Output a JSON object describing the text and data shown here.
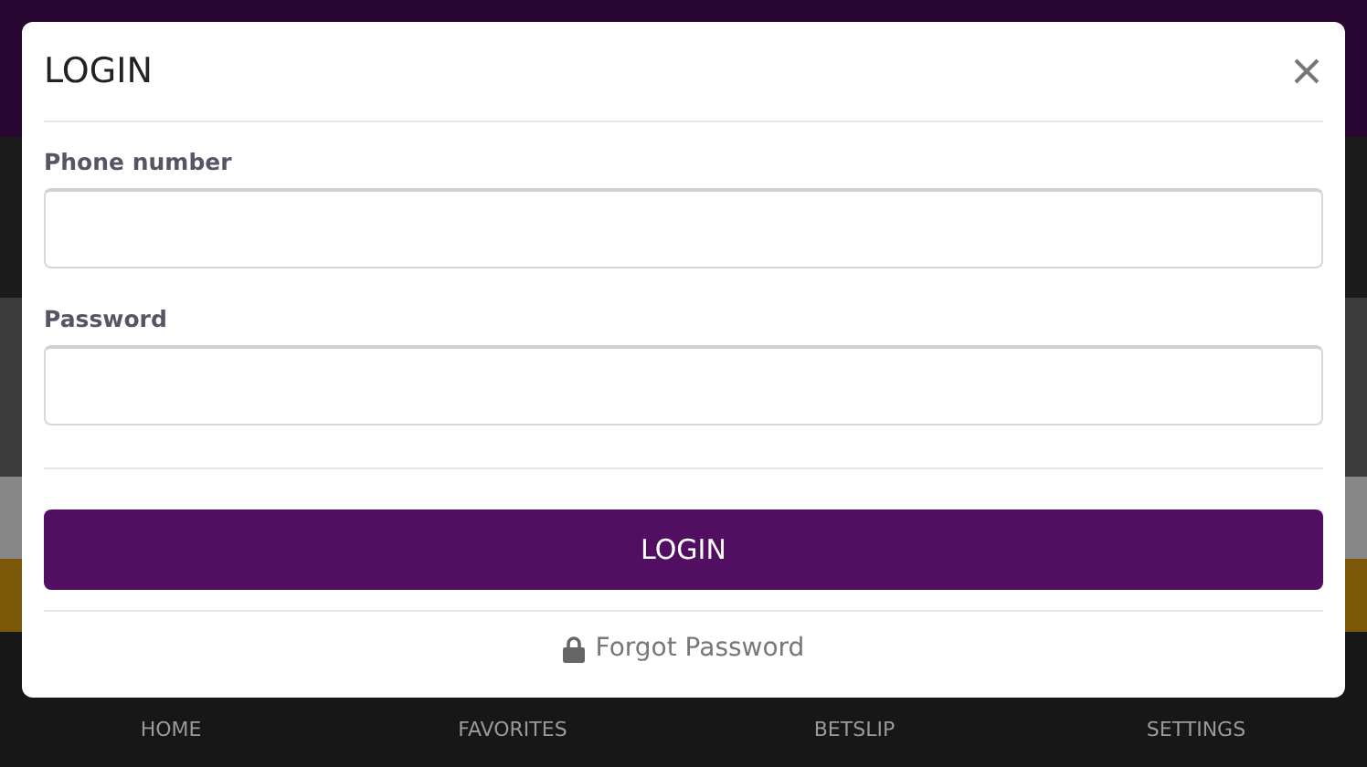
{
  "bottom_nav": [
    {
      "label": "HOME"
    },
    {
      "label": "FAVORITES"
    },
    {
      "label": "BETSLIP"
    },
    {
      "label": "SETTINGS"
    }
  ],
  "dialog": {
    "title": "LOGIN",
    "fields": [
      {
        "label": "Phone number"
      },
      {
        "label": "Password"
      }
    ],
    "submit": "LOGIN",
    "forgot_link": "Forgot Password"
  }
}
